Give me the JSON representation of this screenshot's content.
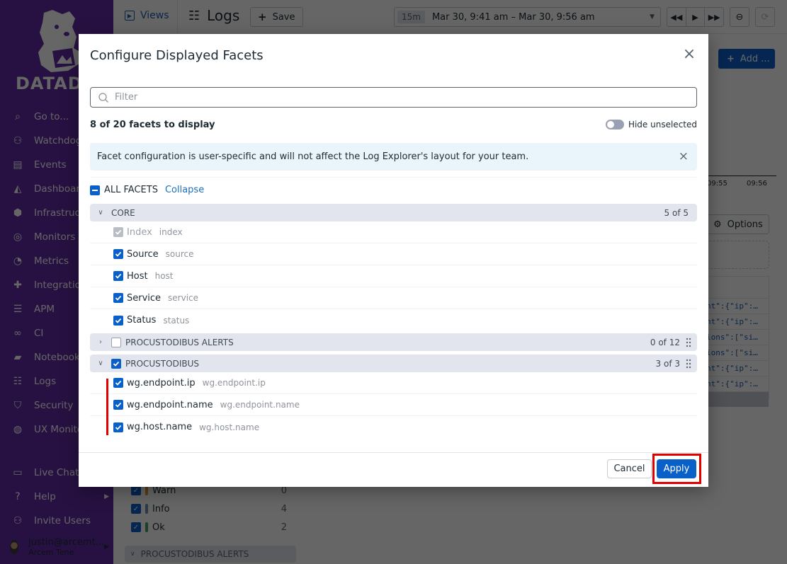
{
  "sidebar": {
    "brand": "DATADOG",
    "items": [
      {
        "label": "Go to...",
        "icon": "search-icon"
      },
      {
        "label": "Watchdog",
        "icon": "binoculars-icon"
      },
      {
        "label": "Events",
        "icon": "events-icon"
      },
      {
        "label": "Dashboards",
        "icon": "dashboard-icon"
      },
      {
        "label": "Infrastructure",
        "icon": "infrastructure-icon"
      },
      {
        "label": "Monitors",
        "icon": "monitor-icon"
      },
      {
        "label": "Metrics",
        "icon": "gauge-icon"
      },
      {
        "label": "Integrations",
        "icon": "puzzle-icon"
      },
      {
        "label": "APM",
        "icon": "apm-icon"
      },
      {
        "label": "CI",
        "icon": "ci-icon"
      },
      {
        "label": "Notebooks",
        "icon": "notebook-icon"
      },
      {
        "label": "Logs",
        "icon": "logs-icon",
        "active": true
      },
      {
        "label": "Security",
        "icon": "shield-icon"
      },
      {
        "label": "UX Monitoring",
        "icon": "globe-icon"
      }
    ],
    "bottom": [
      {
        "label": "Live Chat",
        "icon": "chat-icon"
      },
      {
        "label": "Help",
        "icon": "help-icon"
      },
      {
        "label": "Invite Users",
        "icon": "users-icon"
      }
    ],
    "user": {
      "email": "justin@arcemt...",
      "org": "Arcem Tene"
    }
  },
  "topbar": {
    "views_label": "Views",
    "title": "Logs",
    "save_label": "Save",
    "time_badge": "15m",
    "time_range": "Mar 30, 9:41 am – Mar 30, 9:56 am",
    "add_label": "Add ..."
  },
  "background": {
    "timeline_ticks": [
      "09:55",
      "09:56"
    ],
    "options_label": "Options",
    "log_snippets": [
      "nt\":{\"ip\":…",
      "nt\":{\"ip\":…",
      "ions\":[\"si…",
      "ions\":[\"si…",
      "nt\":{\"ip\":…",
      "nt\":{\"ip\":…"
    ],
    "status_facets": [
      {
        "label": "Warn",
        "count": "0",
        "color": "#e09a36"
      },
      {
        "label": "Info",
        "count": "4",
        "color": "#6b8fb8"
      },
      {
        "label": "Ok",
        "count": "2",
        "color": "#3fa35a"
      }
    ],
    "section_label": "PROCUSTODIBUS ALERTS"
  },
  "modal": {
    "title": "Configure Displayed Facets",
    "filter_placeholder": "Filter",
    "filter_value": "",
    "count_text": "8 of 20 facets to display",
    "hide_unselected_label": "Hide unselected",
    "hide_unselected": false,
    "info_text": "Facet configuration is user-specific and will not affect the Log Explorer's layout for your team.",
    "all_facets_label": "ALL FACETS",
    "collapse_label": "Collapse",
    "groups": [
      {
        "name": "CORE",
        "count": "5 of 5",
        "expanded": true,
        "facets": [
          {
            "label": "Index",
            "path": "index",
            "checked": true,
            "disabled": true
          },
          {
            "label": "Source",
            "path": "source",
            "checked": true
          },
          {
            "label": "Host",
            "path": "host",
            "checked": true
          },
          {
            "label": "Service",
            "path": "service",
            "checked": true
          },
          {
            "label": "Status",
            "path": "status",
            "checked": true
          }
        ]
      },
      {
        "name": "PROCUSTODIBUS ALERTS",
        "count": "0 of 12",
        "expanded": false,
        "checked": false
      },
      {
        "name": "PROCUSTODIBUS",
        "count": "3 of 3",
        "expanded": true,
        "checked": true,
        "facets": [
          {
            "label": "wg.endpoint.ip",
            "path": "wg.endpoint.ip",
            "checked": true
          },
          {
            "label": "wg.endpoint.name",
            "path": "wg.endpoint.name",
            "checked": true
          },
          {
            "label": "wg.host.name",
            "path": "wg.host.name",
            "checked": true
          }
        ]
      }
    ],
    "cancel_label": "Cancel",
    "apply_label": "Apply"
  },
  "colors": {
    "accent": "#0a60c9",
    "highlight": "#e00000",
    "sidebar_bg": "#632ca6"
  }
}
